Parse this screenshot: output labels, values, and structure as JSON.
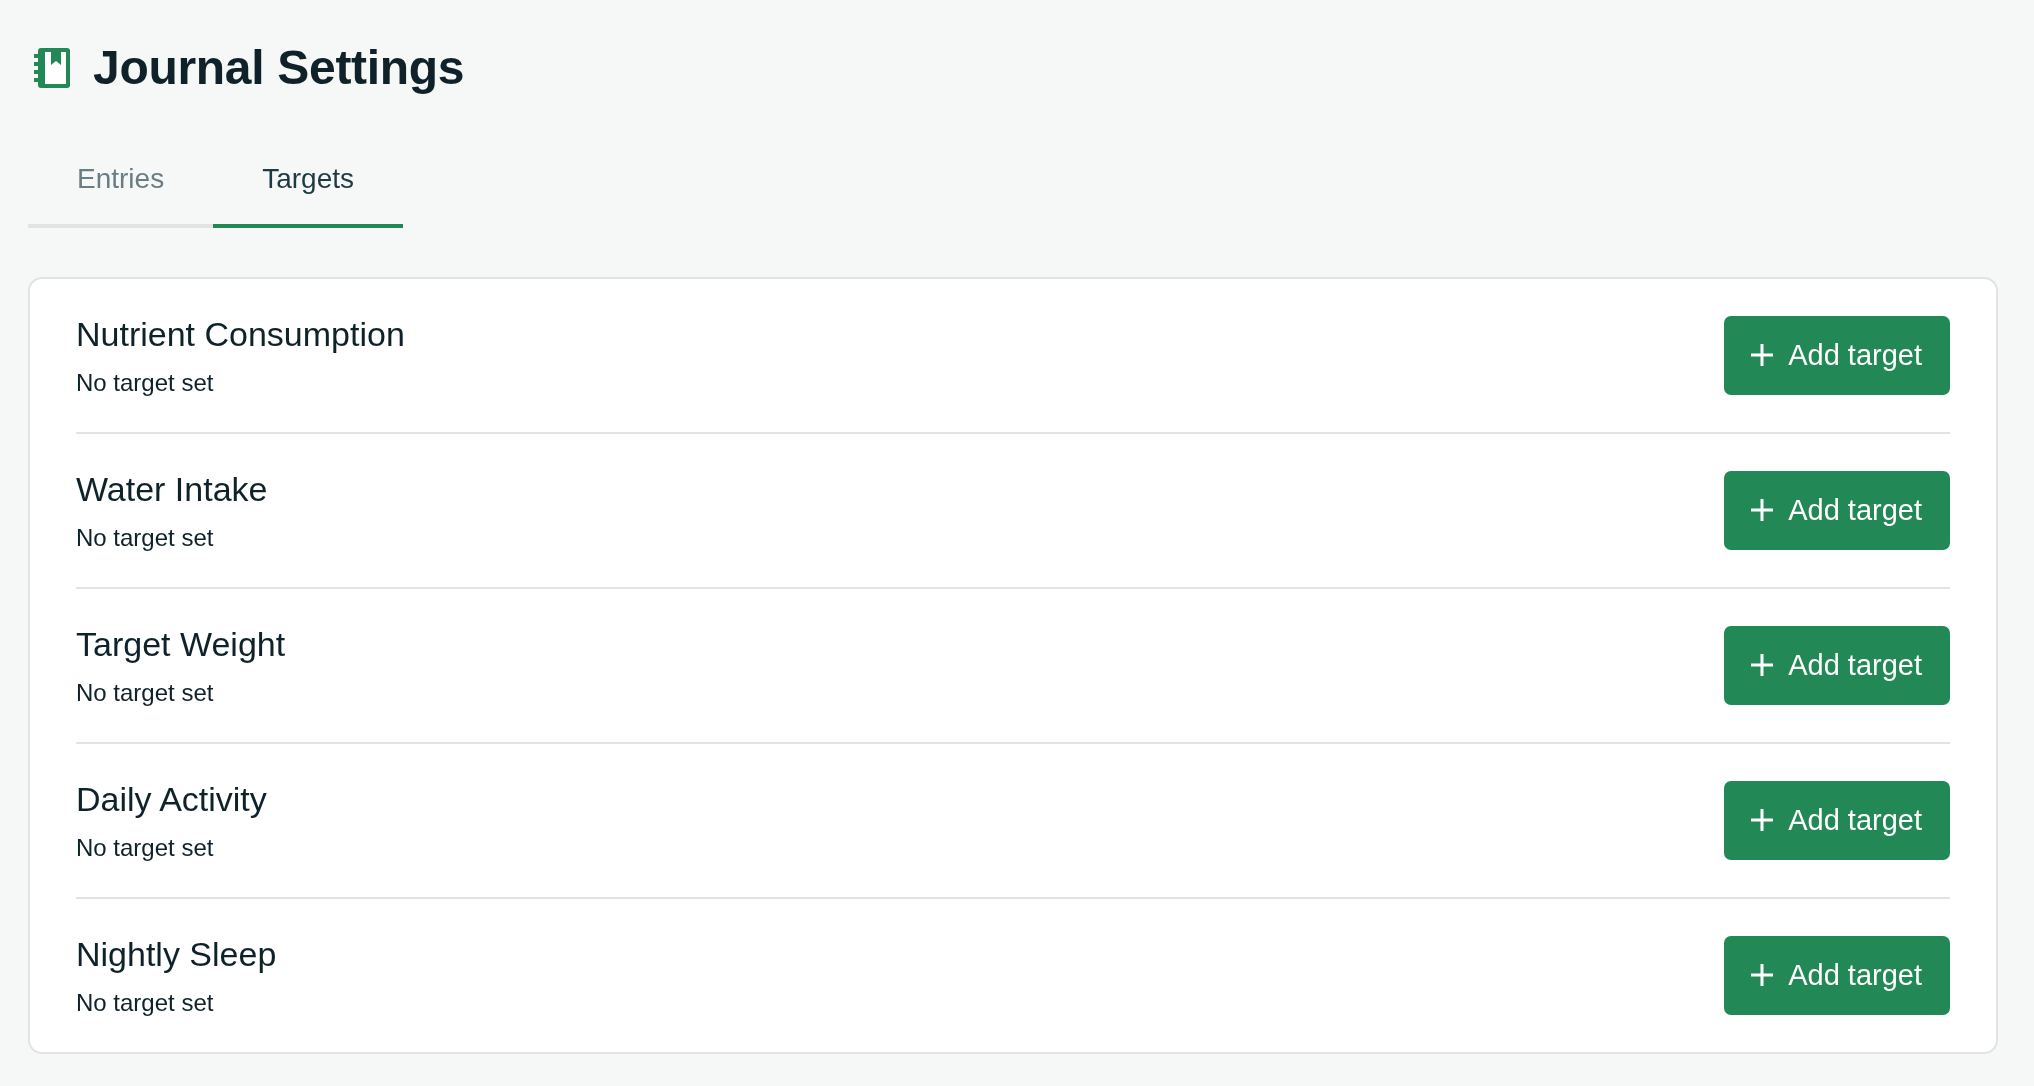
{
  "page": {
    "title": "Journal Settings"
  },
  "tabs": [
    {
      "label": "Entries",
      "selected": false
    },
    {
      "label": "Targets",
      "selected": true
    }
  ],
  "targets": [
    {
      "name": "Nutrient Consumption",
      "status": "No target set",
      "action": "Add target"
    },
    {
      "name": "Water Intake",
      "status": "No target set",
      "action": "Add target"
    },
    {
      "name": "Target Weight",
      "status": "No target set",
      "action": "Add target"
    },
    {
      "name": "Daily Activity",
      "status": "No target set",
      "action": "Add target"
    },
    {
      "name": "Nightly Sleep",
      "status": "No target set",
      "action": "Add target"
    }
  ]
}
